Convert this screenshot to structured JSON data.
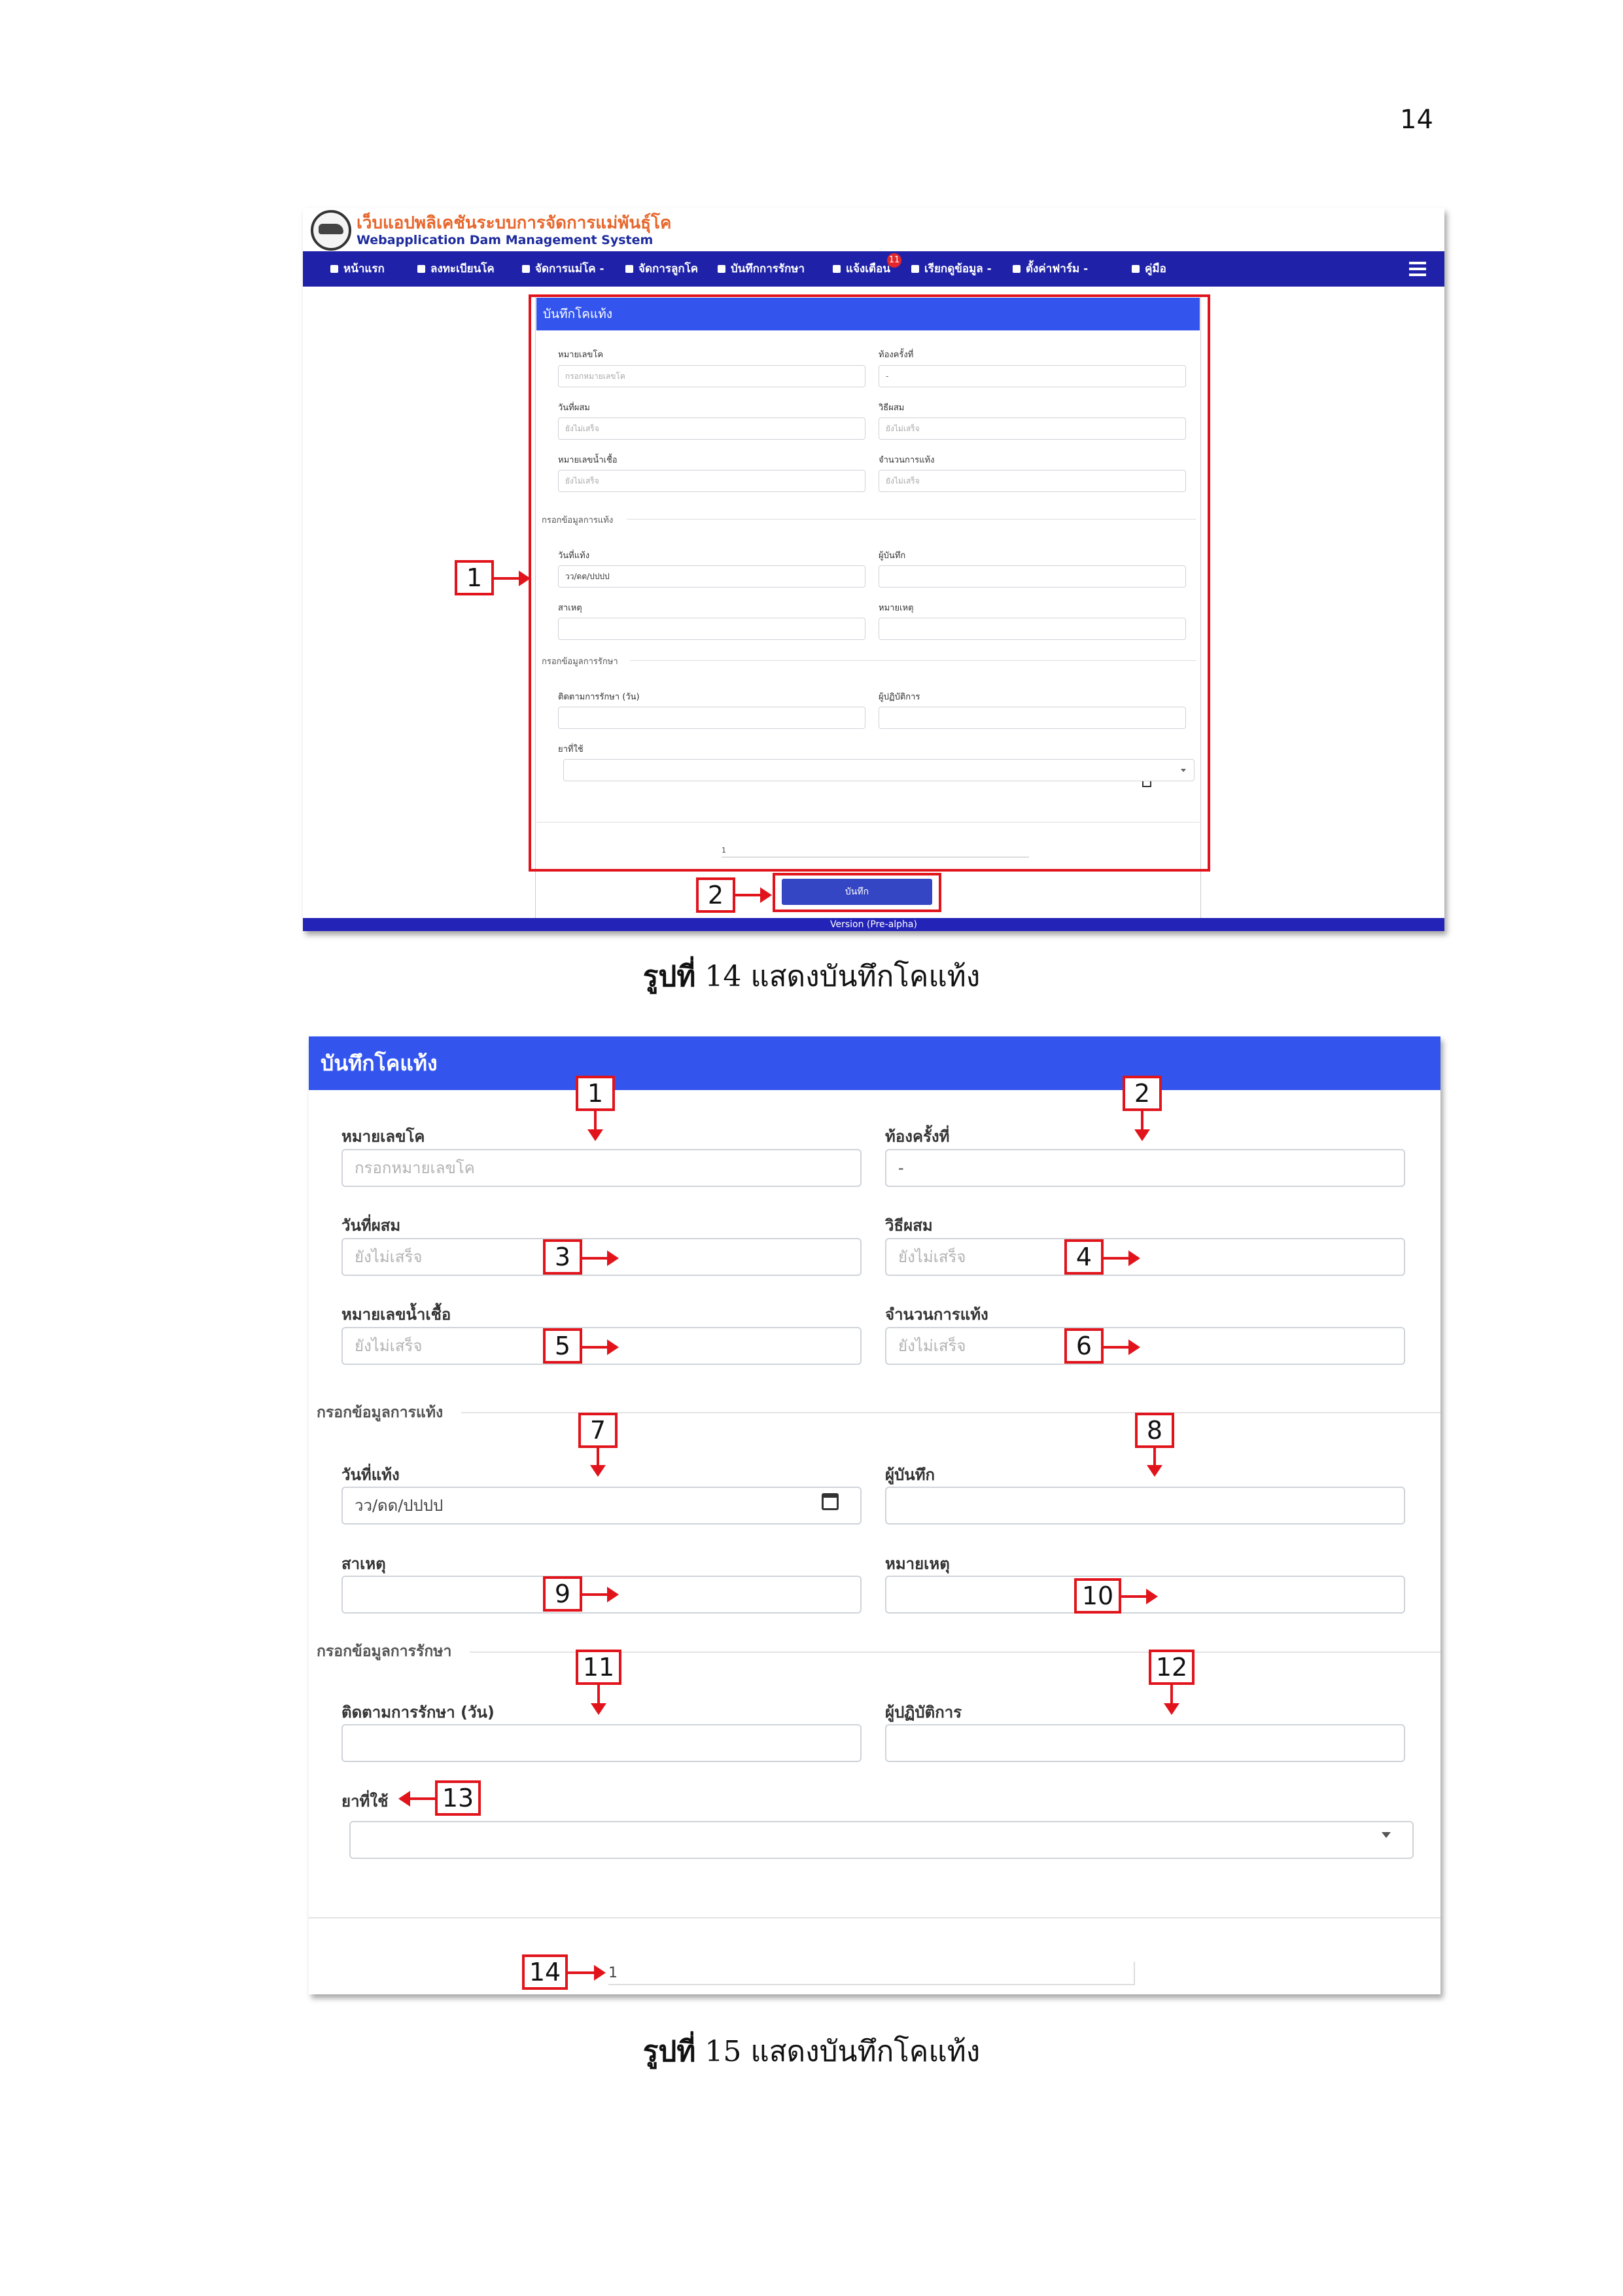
{
  "page_number": "14",
  "figure14": {
    "brand_th": "เว็บแอปพลิเคชันระบบการจัดการแม่พันธุ์โค",
    "brand_en": "Webapplication Dam Management System",
    "nav": [
      "หน้าแรก",
      "ลงทะเบียนโค",
      "จัดการแม่โค -",
      "จัดการลูกโค",
      "บันทึกการรักษา",
      "แจ้งเตือน",
      "เรียกดูข้อมูล -",
      "ตั้งค่าฟาร์ม -",
      "คู่มือ"
    ],
    "notif_count": "11",
    "card_title": "บันทึกโคแท้ง",
    "fields": {
      "cow_id_label": "หมายเลขโค",
      "cow_id_ph": "กรอกหมายเลขโค",
      "preg_label": "ท้องครั้งที่",
      "preg_val": "-",
      "breed_date_label": "วันที่ผสม",
      "breed_date_val": "ยังไม่เสร็จ",
      "method_label": "วิธีผสม",
      "method_val": "ยังไม่เสร็จ",
      "semen_label": "หมายเลขน้ำเชื้อ",
      "semen_val": "ยังไม่เสร็จ",
      "count_label": "จำนวนการแท้ง",
      "count_val": "ยังไม่เสร็จ",
      "sec1": "กรอกข้อมูลการแท้ง",
      "abort_date_label": "วันที่แท้ง",
      "abort_date_ph": "วว/ดด/ปปปป",
      "recorder_label": "ผู้บันทึก",
      "cause_label": "สาเหตุ",
      "note_label": "หมายเหตุ",
      "sec2": "กรอกข้อมูลการรักษา",
      "follow_label": "ติดตามการรักษา (วัน)",
      "operator_label": "ผู้ปฏิบัติการ",
      "drug_label": "ยาที่ใช้",
      "row_count": "1"
    },
    "save_button": "บันทึก",
    "version": "Version (Pre-alpha)",
    "badges": [
      "1",
      "2"
    ]
  },
  "caption14": {
    "bold": "รูปที่",
    "rest": " 14 แสดงบันทึกโคแท้ง"
  },
  "figure15": {
    "card_title": "บันทึกโคแท้ง",
    "badges": [
      "1",
      "2",
      "3",
      "4",
      "5",
      "6",
      "7",
      "8",
      "9",
      "10",
      "11",
      "12",
      "13",
      "14"
    ]
  },
  "caption15": {
    "bold": "รูปที่",
    "rest": " 15 แสดงบันทึกโคแท้ง"
  }
}
